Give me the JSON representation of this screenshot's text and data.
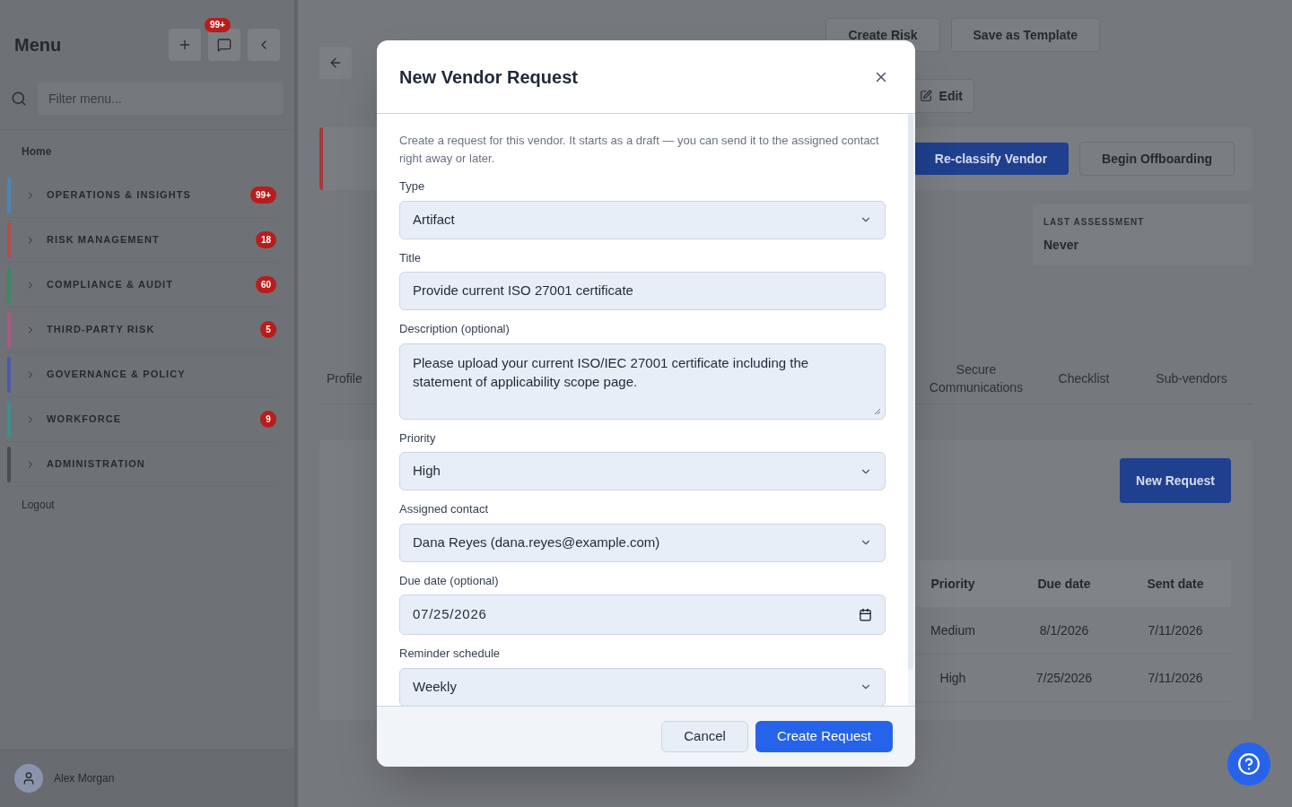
{
  "sidebar": {
    "title": "Menu",
    "notification_badge": "99+",
    "search": {
      "placeholder": "Filter menu..."
    },
    "home": "Home",
    "items": [
      {
        "label": "OPERATIONS & INSIGHTS",
        "color": "#4a86b8",
        "badge": "99+",
        "expanded": false
      },
      {
        "label": "RISK MANAGEMENT",
        "color": "#b84a4a",
        "badge": "18",
        "expanded": false
      },
      {
        "label": "COMPLIANCE & AUDIT",
        "color": "#3a8a68",
        "badge": "60",
        "expanded": false
      },
      {
        "label": "THIRD-PARTY RISK",
        "color": "#b0587f",
        "badge": "5",
        "expanded": false
      },
      {
        "label": "GOVERNANCE & POLICY",
        "color": "#4c58b0",
        "expanded": false
      },
      {
        "label": "WORKFORCE",
        "color": "#3a9090",
        "badge": "9",
        "expanded": false
      },
      {
        "label": "ADMINISTRATION",
        "color": "#4a4d52",
        "expanded": false
      }
    ],
    "logout": "Logout",
    "user": {
      "name": "Alex Morgan"
    }
  },
  "page": {
    "actions": [
      "Create Risk",
      "Save as Template"
    ],
    "edit": "Edit",
    "primary_action": "Re-classify Vendor",
    "secondary_action": "Begin Offboarding",
    "last_assessment": {
      "label": "LAST ASSESSMENT",
      "value": "Never"
    },
    "tabs": [
      "Profile",
      "Secure Communications",
      "Checklist",
      "Sub-vendors"
    ],
    "new_request": "New Request",
    "table": {
      "columns": [
        "Priority",
        "Due date",
        "Sent date"
      ],
      "rows": [
        [
          "Medium",
          "8/1/2026",
          "7/11/2026"
        ],
        [
          "High",
          "7/25/2026",
          "7/11/2026"
        ]
      ]
    }
  },
  "modal": {
    "title": "New Vendor Request",
    "intro": "Create a request for this vendor. It starts as a draft — you can send it to the assigned contact right away or later.",
    "fields": [
      {
        "kind": "select",
        "label": "Type",
        "value": "Artifact"
      },
      {
        "kind": "text",
        "label": "Title",
        "value": "Provide current ISO 27001 certificate"
      },
      {
        "kind": "textarea",
        "label": "Description (optional)",
        "value": "Please upload your current ISO/IEC 27001 certificate including the statement of applicability scope page."
      },
      {
        "kind": "select",
        "label": "Priority",
        "value": "High"
      },
      {
        "kind": "select",
        "label": "Assigned contact",
        "value": "Dana Reyes (dana.reyes@example.com)"
      },
      {
        "kind": "date",
        "label": "Due date (optional)",
        "value": "07/25/2026"
      },
      {
        "kind": "select",
        "label": "Reminder schedule",
        "value": "Weekly"
      }
    ],
    "buttons": {
      "cancel": "Cancel",
      "submit": "Create Request"
    }
  }
}
